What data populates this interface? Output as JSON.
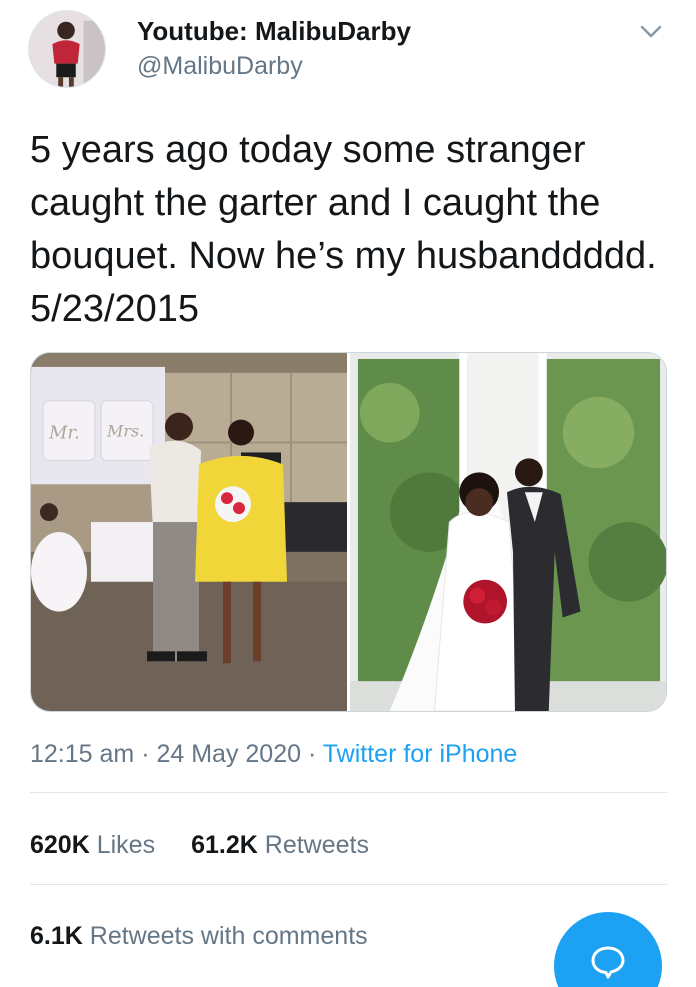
{
  "user": {
    "display_name": "Youtube: MalibuDarby",
    "handle": "@MalibuDarby",
    "avatar_icon": "profile-photo"
  },
  "tweet": {
    "text": "5 years ago today some stranger caught the garter and I caught the bouquet. Now he’s my husbanddddd. 5/23/2015",
    "photo_sign_left": "Mr.",
    "photo_sign_right": "Mrs."
  },
  "meta": {
    "time": "12:15 am",
    "sep1": " · ",
    "date": "24 May 2020",
    "sep2": " · ",
    "source": "Twitter for iPhone"
  },
  "stats": {
    "likes_count": "620K",
    "likes_label": "Likes",
    "retweets_count": "61.2K",
    "retweets_label": "Retweets",
    "rt_comments_count": "6.1K",
    "rt_comments_label": "Retweets with comments"
  },
  "colors": {
    "accent": "#1da1f2",
    "secondary_text": "#657786",
    "primary_text": "#14171a",
    "divider": "#e1e8ed"
  },
  "icons": {
    "menu": "chevron-down-icon",
    "compose": "reply-bubble-icon"
  }
}
